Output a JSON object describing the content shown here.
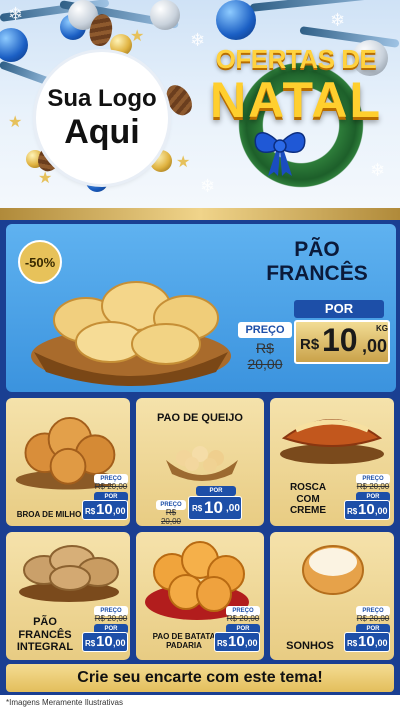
{
  "header": {
    "logo_line1": "Sua Logo",
    "logo_line2": "Aqui",
    "title_top": "OFERTAS DE",
    "title_main": "NATAL"
  },
  "featured": {
    "name": "PÃO FRANCÊS",
    "discount": "-50%",
    "price": {
      "preco_label": "PREÇO",
      "old_price": "R$ 20,00",
      "por_label": "POR",
      "currency": "R$",
      "integer": "10",
      "decimal": ",00",
      "unit": "KG"
    }
  },
  "products": [
    {
      "name": "BROA DE MILHO",
      "preco_label": "PREÇO",
      "old_price": "R$ 20,00",
      "por_label": "POR",
      "currency": "R$",
      "integer": "10",
      "decimal": ",00",
      "unit": "KG"
    },
    {
      "name": "PAO DE QUEIJO",
      "preco_label": "PREÇO",
      "old_price": "R$ 20,00",
      "por_label": "POR",
      "currency": "R$",
      "integer": "10",
      "decimal": ",00",
      "unit": "KG"
    },
    {
      "name": "ROSCA COM CREME",
      "preco_label": "PREÇO",
      "old_price": "R$ 20,00",
      "por_label": "POR",
      "currency": "R$",
      "integer": "10",
      "decimal": ",00",
      "unit": "KG"
    },
    {
      "name": "PÃO FRANCÊS INTEGRAL",
      "preco_label": "PREÇO",
      "old_price": "R$ 20,00",
      "por_label": "POR",
      "currency": "R$",
      "integer": "10",
      "decimal": ",00",
      "unit": "KG"
    },
    {
      "name": "PAO DE BATATA PADARIA",
      "preco_label": "PREÇO",
      "old_price": "R$ 20,00",
      "por_label": "POR",
      "currency": "R$",
      "integer": "10",
      "decimal": ",00",
      "unit": "KG"
    },
    {
      "name": "SONHOS",
      "preco_label": "PREÇO",
      "old_price": "R$ 20,00",
      "por_label": "POR",
      "currency": "R$",
      "integer": "10",
      "decimal": ",00",
      "unit": "KG"
    }
  ],
  "footer": {
    "cta": "Crie seu encarte com este tema!",
    "disclaimer": "*Imagens Meramente Ilustrativas"
  },
  "colors": {
    "main_background": "#1a3f92",
    "accent_gold": "#e3be5c",
    "title_yellow": "#ffcf2e",
    "bow_blue": "#1f58d6"
  },
  "icons": [
    "snowflake-icon",
    "star-icon",
    "bow-icon"
  ]
}
